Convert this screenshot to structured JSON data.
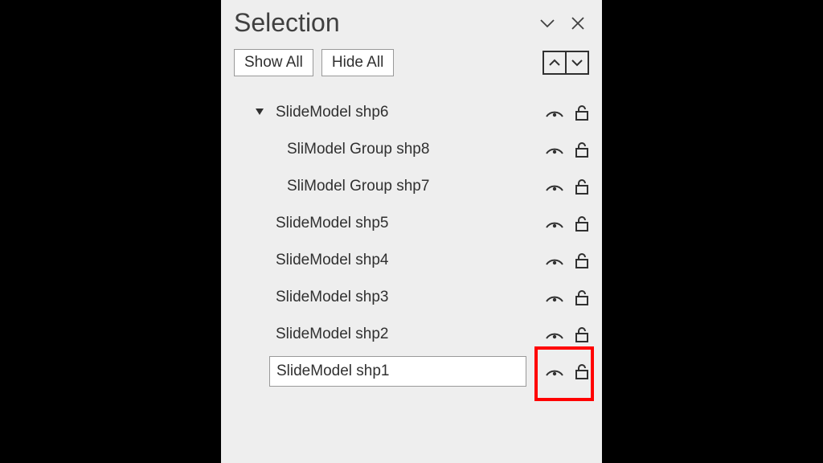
{
  "panel": {
    "title": "Selection",
    "buttons": {
      "show_all": "Show All",
      "hide_all": "Hide All"
    }
  },
  "items": [
    {
      "label": "SlideModel shp6",
      "level": 1,
      "expandable": true,
      "expanded": true,
      "visible": true,
      "locked": false,
      "selected": false
    },
    {
      "label": "SliModel Group shp8",
      "level": 2,
      "expandable": false,
      "expanded": false,
      "visible": true,
      "locked": false,
      "selected": false
    },
    {
      "label": "SliModel Group shp7",
      "level": 2,
      "expandable": false,
      "expanded": false,
      "visible": true,
      "locked": false,
      "selected": false
    },
    {
      "label": "SlideModel shp5",
      "level": 1,
      "expandable": false,
      "expanded": false,
      "visible": true,
      "locked": false,
      "selected": false
    },
    {
      "label": "SlideModel shp4",
      "level": 1,
      "expandable": false,
      "expanded": false,
      "visible": true,
      "locked": false,
      "selected": false
    },
    {
      "label": "SlideModel shp3",
      "level": 1,
      "expandable": false,
      "expanded": false,
      "visible": true,
      "locked": false,
      "selected": false
    },
    {
      "label": "SlideModel shp2",
      "level": 1,
      "expandable": false,
      "expanded": false,
      "visible": true,
      "locked": false,
      "selected": false
    },
    {
      "label": "SlideModel shp1",
      "level": 1,
      "expandable": false,
      "expanded": false,
      "visible": true,
      "locked": false,
      "selected": true,
      "highlight_lock": true
    }
  ]
}
